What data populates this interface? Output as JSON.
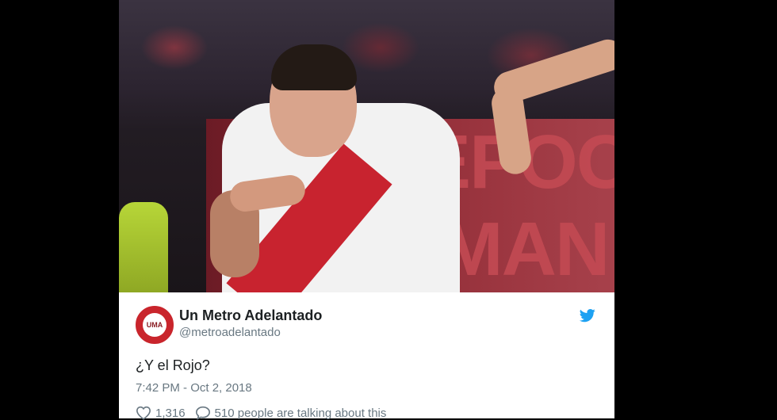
{
  "tweet": {
    "author_name": "Un Metro Adelantado",
    "handle": "@metroadelantado",
    "avatar_text": "UMA",
    "text": "¿Y el Rojo?",
    "timestamp": "7:42 PM - Oct 2, 2018",
    "likes": "1,316",
    "talking": "510 people are talking about this"
  },
  "photo": {
    "banner_text": "EPOO\nIMAN"
  },
  "icons": {
    "brand": "twitter-bird-icon",
    "like": "heart-icon",
    "reply": "speech-bubble-icon"
  },
  "colors": {
    "twitter_blue": "#1da1f2",
    "muted_text": "#697882",
    "avatar_red": "#c9252c"
  }
}
